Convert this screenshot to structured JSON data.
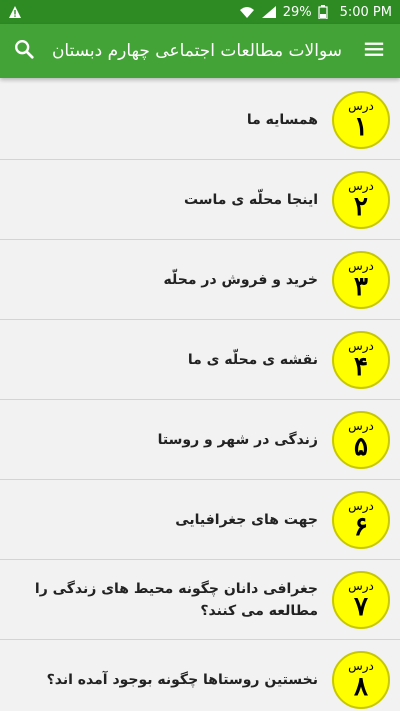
{
  "status_bar": {
    "warning_icon": "warning-icon",
    "battery_percent": "29%",
    "time": "5:00 PM"
  },
  "app_bar": {
    "title": "سوالات مطالعات اجتماعی چهارم دبستان",
    "background": "#44a336"
  },
  "list": {
    "badge_color": "#ffff00",
    "items": [
      {
        "label": "درس",
        "number": "۱",
        "title": "همسایه ما"
      },
      {
        "label": "درس",
        "number": "۲",
        "title": "اینجا محلّه ی ماست"
      },
      {
        "label": "درس",
        "number": "۳",
        "title": "خرید و فروش در محلّه"
      },
      {
        "label": "درس",
        "number": "۴",
        "title": "نقشه ی محلّه ی ما"
      },
      {
        "label": "درس",
        "number": "۵",
        "title": "زندگی در شهر و روستا"
      },
      {
        "label": "درس",
        "number": "۶",
        "title": "جهت های جغرافیایی"
      },
      {
        "label": "درس",
        "number": "۷",
        "title": "جغرافی دانان چگونه محیط های زندگی را مطالعه می کنند؟"
      },
      {
        "label": "درس",
        "number": "۸",
        "title": "نخستین روستاها چگونه بوجود آمده اند؟"
      }
    ]
  }
}
